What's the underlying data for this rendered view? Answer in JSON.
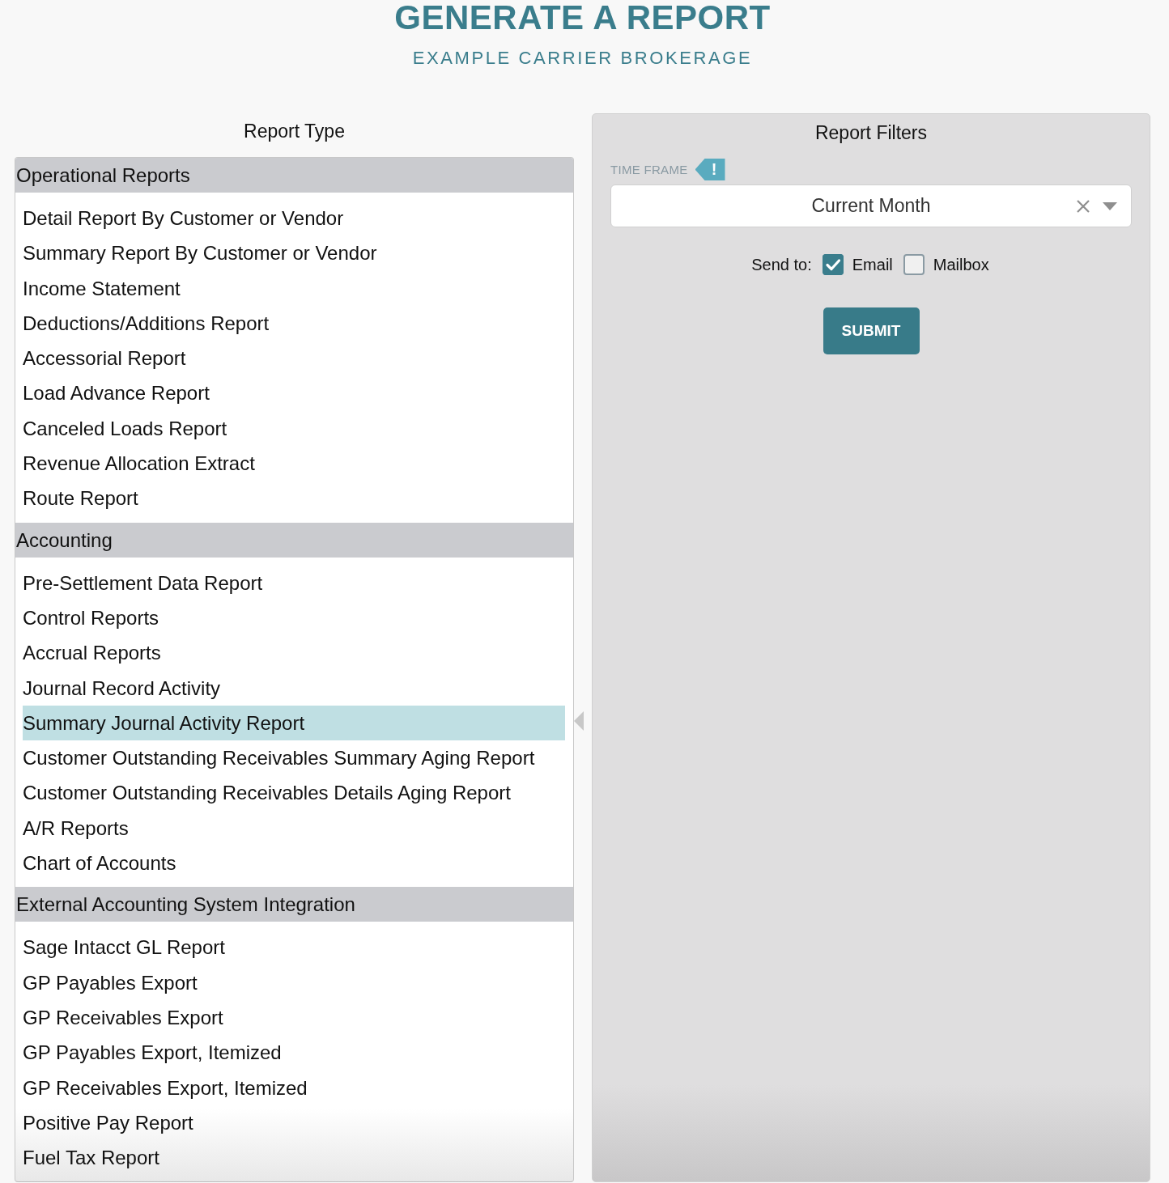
{
  "header": {
    "title": "GENERATE A REPORT",
    "subtitle": "EXAMPLE CARRIER BROKERAGE"
  },
  "report_type": {
    "heading": "Report Type",
    "groups": [
      {
        "label": "Operational Reports",
        "items": [
          {
            "label": "Detail Report By Customer or Vendor",
            "selected": false
          },
          {
            "label": "Summary Report By Customer or Vendor",
            "selected": false
          },
          {
            "label": "Income Statement",
            "selected": false
          },
          {
            "label": "Deductions/Additions Report",
            "selected": false
          },
          {
            "label": "Accessorial Report",
            "selected": false
          },
          {
            "label": "Load Advance Report",
            "selected": false
          },
          {
            "label": "Canceled Loads Report",
            "selected": false
          },
          {
            "label": "Revenue Allocation Extract",
            "selected": false
          },
          {
            "label": "Route Report",
            "selected": false
          }
        ]
      },
      {
        "label": "Accounting",
        "items": [
          {
            "label": "Pre-Settlement Data Report",
            "selected": false
          },
          {
            "label": "Control Reports",
            "selected": false
          },
          {
            "label": "Accrual Reports",
            "selected": false
          },
          {
            "label": "Journal Record Activity",
            "selected": false
          },
          {
            "label": "Summary Journal Activity Report",
            "selected": true
          },
          {
            "label": "Customer Outstanding Receivables Summary Aging Report",
            "selected": false
          },
          {
            "label": "Customer Outstanding Receivables Details Aging Report",
            "selected": false
          },
          {
            "label": "A/R Reports",
            "selected": false
          },
          {
            "label": "Chart of Accounts",
            "selected": false
          }
        ]
      },
      {
        "label": "External Accounting System Integration",
        "items": [
          {
            "label": "Sage Intacct GL Report",
            "selected": false
          },
          {
            "label": "GP Payables Export",
            "selected": false
          },
          {
            "label": "GP Receivables Export",
            "selected": false
          },
          {
            "label": "GP Payables Export, Itemized",
            "selected": false
          },
          {
            "label": "GP Receivables Export, Itemized",
            "selected": false
          },
          {
            "label": "Positive Pay Report",
            "selected": false
          },
          {
            "label": "Fuel Tax Report",
            "selected": false
          }
        ]
      }
    ]
  },
  "report_filters": {
    "heading": "Report Filters",
    "time_frame": {
      "label": "TIME FRAME",
      "badge": "!",
      "value": "Current Month"
    },
    "send_to": {
      "label": "Send to:",
      "options": [
        {
          "label": "Email",
          "checked": true
        },
        {
          "label": "Mailbox",
          "checked": false
        }
      ]
    },
    "submit": "SUBMIT"
  }
}
